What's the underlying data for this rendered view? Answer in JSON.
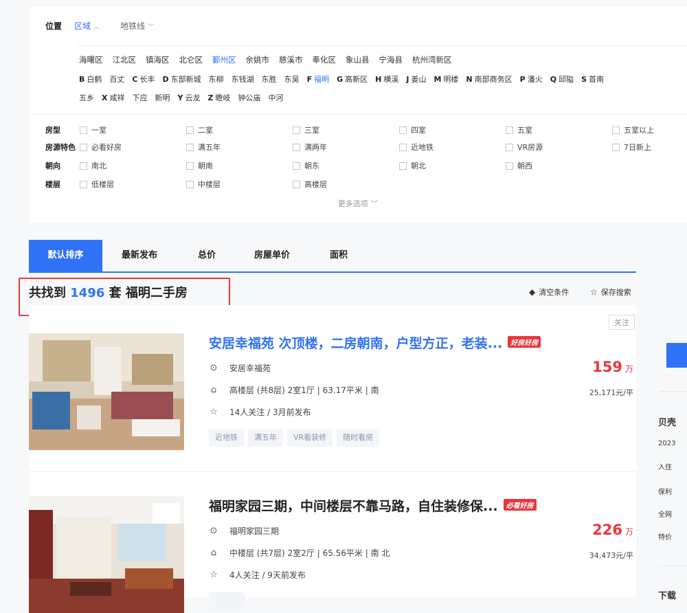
{
  "location": {
    "label": "位置",
    "options": [
      {
        "label": "区域",
        "chevron": "︿",
        "active": true
      },
      {
        "label": "地铁线",
        "chevron": "﹀",
        "active": false
      }
    ]
  },
  "districts": [
    "海曙区",
    "江北区",
    "镇海区",
    "北仑区",
    "鄞州区",
    "余姚市",
    "慈溪市",
    "奉化区",
    "象山县",
    "宁海县",
    "杭州湾新区"
  ],
  "active_district": "鄞州区",
  "areas_line1": [
    {
      "letter": "B",
      "name": "白鹤"
    },
    {
      "letter": "",
      "name": "百丈"
    },
    {
      "letter": "C",
      "name": "长丰"
    },
    {
      "letter": "D",
      "name": "东部新城"
    },
    {
      "letter": "",
      "name": "东柳"
    },
    {
      "letter": "",
      "name": "东钱湖"
    },
    {
      "letter": "",
      "name": "东胜"
    },
    {
      "letter": "",
      "name": "东吴"
    },
    {
      "letter": "F",
      "name": "福明",
      "active": true
    },
    {
      "letter": "G",
      "name": "高新区"
    },
    {
      "letter": "H",
      "name": "横溪"
    },
    {
      "letter": "J",
      "name": "姜山"
    },
    {
      "letter": "M",
      "name": "明楼"
    },
    {
      "letter": "N",
      "name": "南部商务区"
    },
    {
      "letter": "P",
      "name": "潘火"
    },
    {
      "letter": "Q",
      "name": "邱隘"
    },
    {
      "letter": "S",
      "name": "首南"
    }
  ],
  "areas_line2": [
    {
      "letter": "",
      "name": "五乡"
    },
    {
      "letter": "X",
      "name": "咸祥"
    },
    {
      "letter": "",
      "name": "下应"
    },
    {
      "letter": "",
      "name": "新明"
    },
    {
      "letter": "Y",
      "name": "云龙"
    },
    {
      "letter": "Z",
      "name": "瞻岐"
    },
    {
      "letter": "",
      "name": "钟公庙"
    },
    {
      "letter": "",
      "name": "中河"
    }
  ],
  "filters": {
    "layout": {
      "label": "房型",
      "options": [
        "一室",
        "二室",
        "三室",
        "四室",
        "五室",
        "五室以上"
      ]
    },
    "features": {
      "label": "房源特色",
      "options": [
        "必看好房",
        "满五年",
        "满两年",
        "近地铁",
        "VR房源",
        "7日新上"
      ]
    },
    "orientation": {
      "label": "朝向",
      "options": [
        "南北",
        "朝南",
        "朝东",
        "朝北",
        "朝西"
      ]
    },
    "floor": {
      "label": "楼层",
      "options": [
        "低楼层",
        "中楼层",
        "高楼层"
      ]
    }
  },
  "more_options": "更多选项 ﹀",
  "sort_tabs": [
    "默认排序",
    "最新发布",
    "总价",
    "房屋单价",
    "面积"
  ],
  "result": {
    "prefix": "共找到 ",
    "count": "1496",
    "suffix": " 套 福明二手房"
  },
  "tools": {
    "clear": "清空条件",
    "save": "保存搜索"
  },
  "follow_label": "关注",
  "listings": [
    {
      "title": "安居幸福苑 次顶楼，二房朝南，户型方正，老装...",
      "badge": "好房好房",
      "community": "安居幸福苑",
      "detail": "高楼层 (共8层) 2室1厅 | 63.17平米 | 南",
      "meta": "14人关注 / 3月前发布",
      "tags": [
        "近地铁",
        "满五年",
        "VR看装修",
        "随时看房"
      ],
      "price": "159",
      "price_unit": "万",
      "unit_price": "25,171元/平"
    },
    {
      "title": "福明家园三期，中间楼层不靠马路，自住装修保...",
      "badge": "必看好房",
      "community": "福明家园三期",
      "detail": "中楼层 (共7层) 2室2厅 | 65.56平米 | 南 北",
      "meta": "4人关注 / 9天前发布",
      "tags": [],
      "price": "226",
      "price_unit": "万",
      "unit_price": "34,473元/平"
    }
  ],
  "right_panel": {
    "title": "贝壳",
    "lines": [
      "2023",
      "入住",
      "保利",
      "全网",
      "特价"
    ],
    "bottom": "下载"
  },
  "icons": {
    "location": "location-pin-icon",
    "house": "house-icon",
    "star": "star-icon",
    "eraser": "eraser-icon"
  },
  "colors": {
    "accent": "#3072f6",
    "price": "#e8373f"
  }
}
